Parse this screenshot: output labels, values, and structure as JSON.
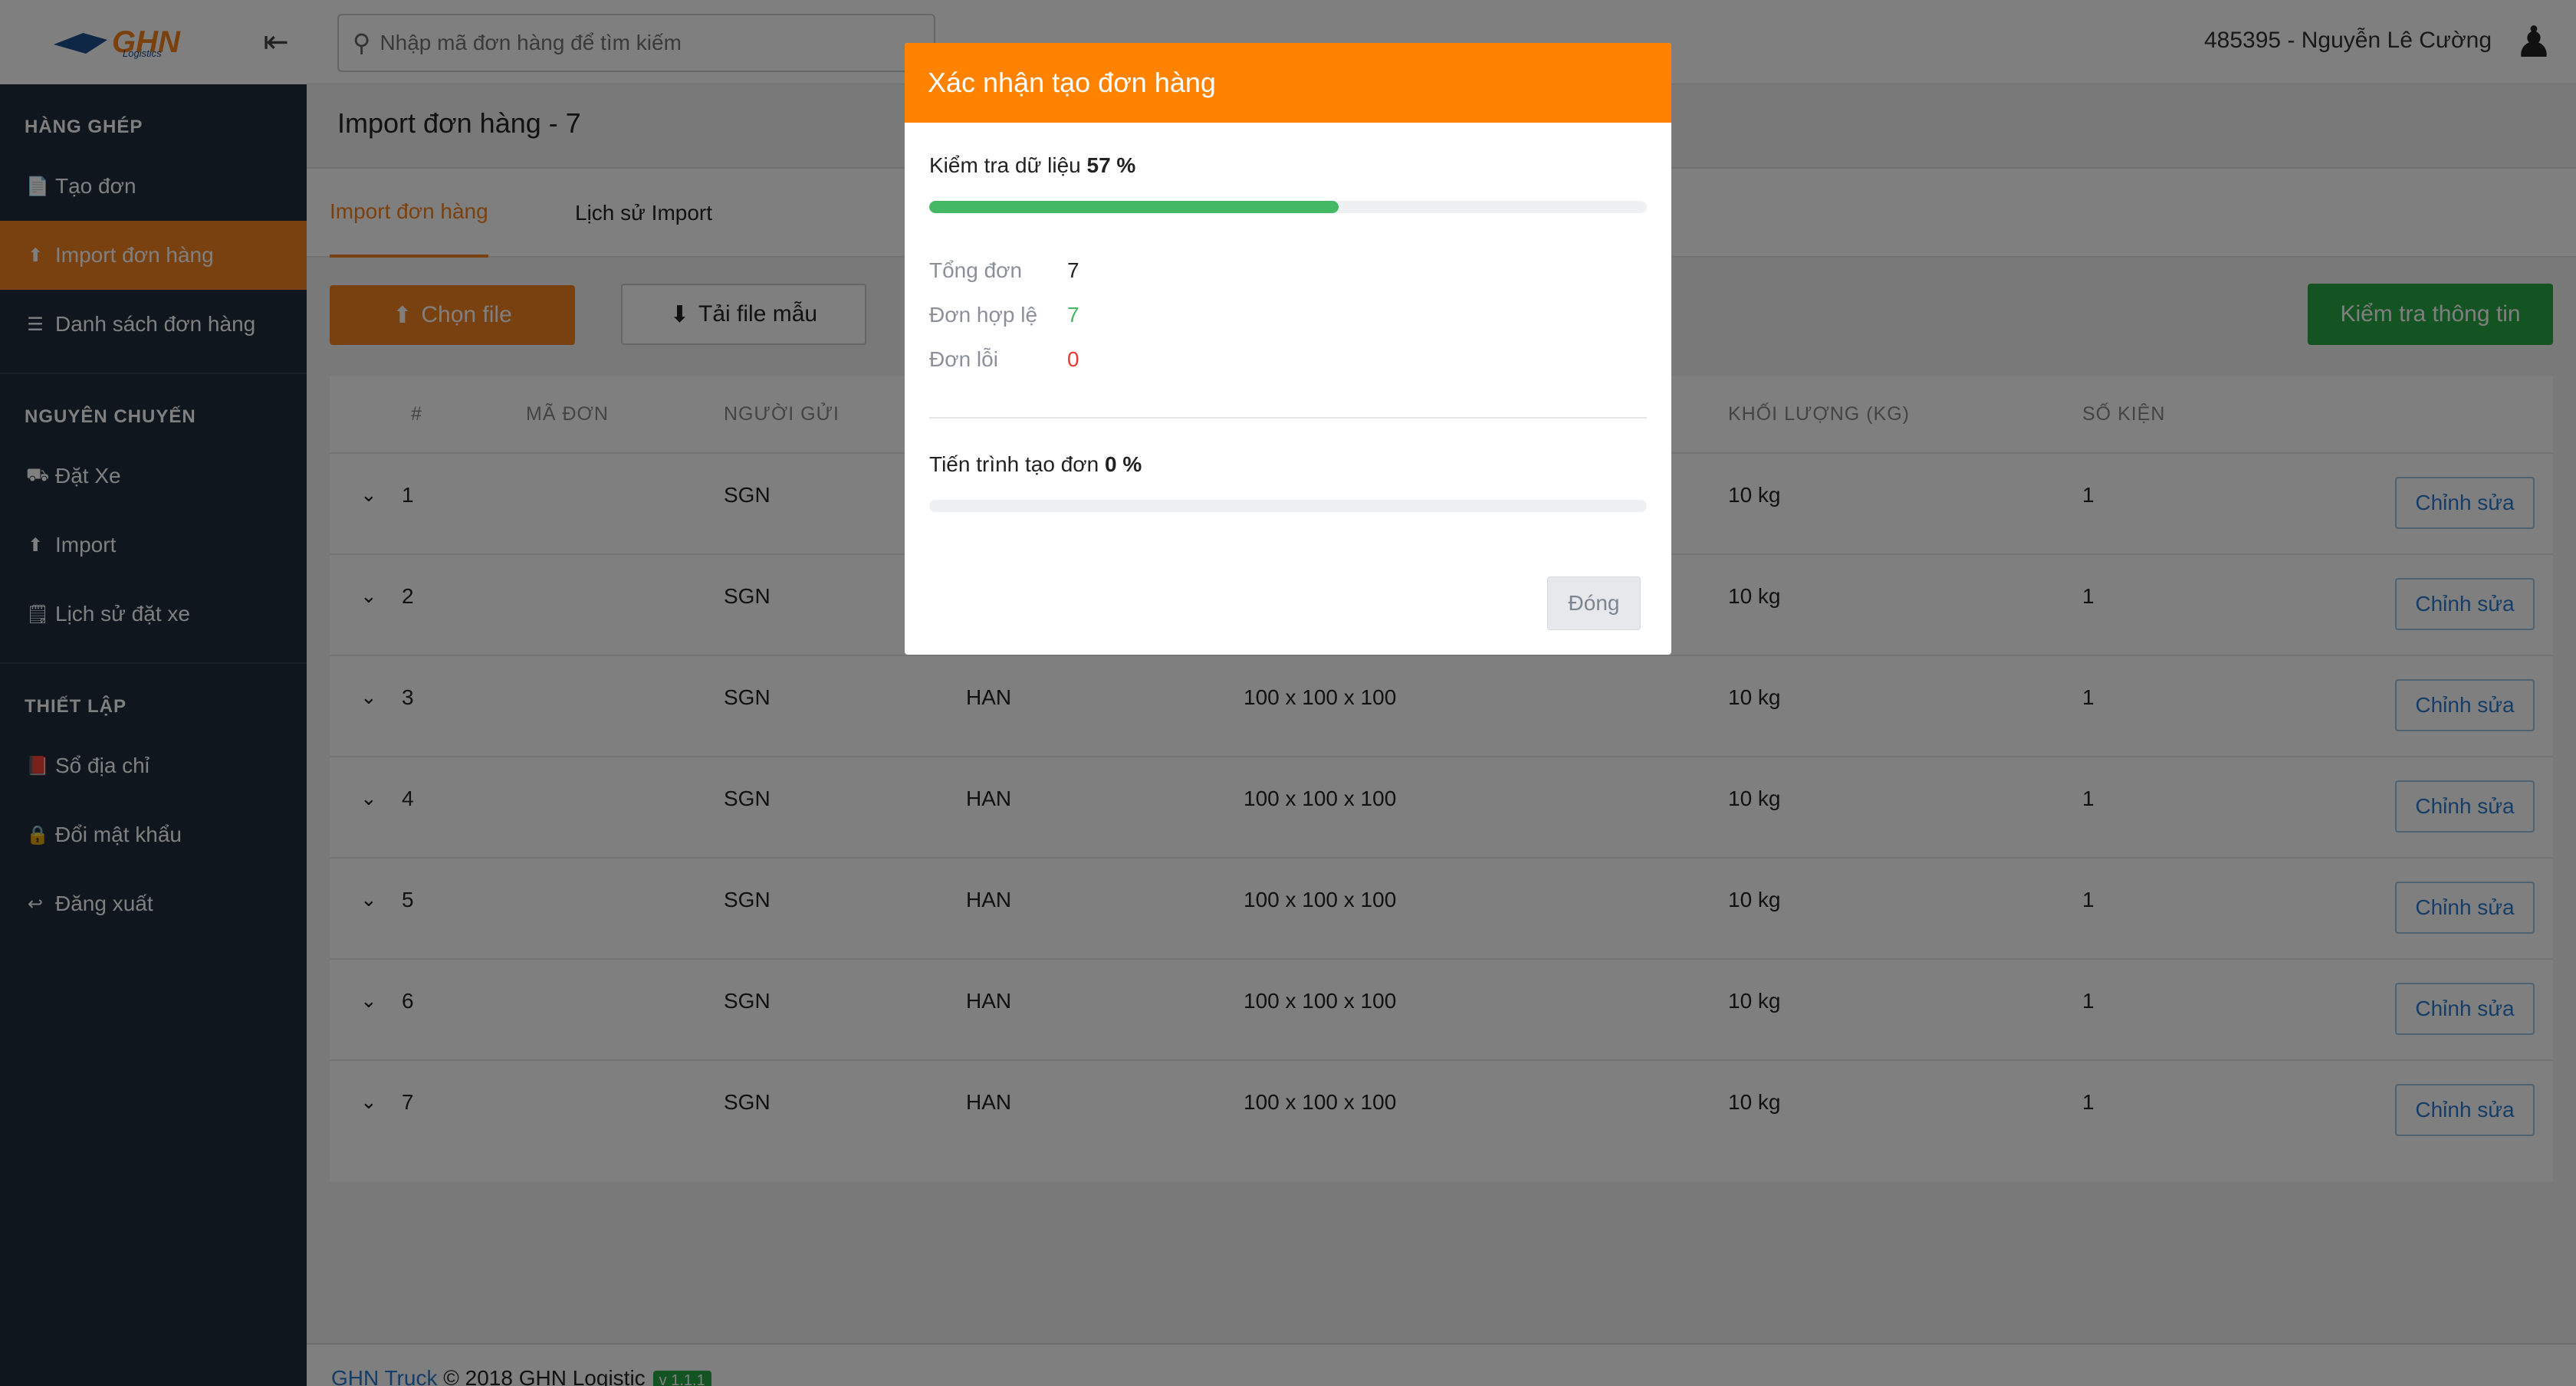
{
  "brand": {
    "logo_text": "GHN",
    "logo_sub": "Logistics"
  },
  "topbar": {
    "search_placeholder": "Nhập mã đơn hàng để tìm kiếm",
    "user": "485395 - Nguyễn Lê Cường"
  },
  "sidebar": {
    "sections": [
      {
        "title": "HÀNG GHÉP",
        "items": [
          {
            "label": "Tạo đơn",
            "icon": "document-icon",
            "active": false
          },
          {
            "label": "Import đơn hàng",
            "icon": "upload-icon",
            "active": true
          },
          {
            "label": "Danh sách đơn hàng",
            "icon": "list-icon",
            "active": false
          }
        ]
      },
      {
        "title": "NGUYÊN CHUYẾN",
        "items": [
          {
            "label": "Đặt Xe",
            "icon": "truck-icon",
            "active": false
          },
          {
            "label": "Import",
            "icon": "upload-icon",
            "active": false
          },
          {
            "label": "Lịch sử đặt xe",
            "icon": "history-icon",
            "active": false
          }
        ]
      },
      {
        "title": "THIẾT LẬP",
        "items": [
          {
            "label": "Sổ địa chỉ",
            "icon": "address-book-icon",
            "active": false
          },
          {
            "label": "Đổi mật khẩu",
            "icon": "lock-icon",
            "active": false
          },
          {
            "label": "Đăng xuất",
            "icon": "logout-icon",
            "active": false
          }
        ]
      }
    ]
  },
  "page": {
    "title": "Import đơn hàng - 7"
  },
  "tabs": [
    {
      "label": "Import đơn hàng",
      "active": true
    },
    {
      "label": "Lịch sử Import",
      "active": false
    }
  ],
  "toolbar": {
    "choose_file": "Chọn file",
    "download_template": "Tải file mẫu",
    "check_info": "Kiểm tra thông tin"
  },
  "table": {
    "headers": [
      "#",
      "MÃ ĐƠN",
      "NGƯỜI GỬI",
      "KHỐI LƯỢNG (KG)",
      "SỐ KIỆN"
    ],
    "edit_label": "Chỉnh sửa",
    "rows": [
      {
        "no": "1",
        "from": "SGN",
        "to": "",
        "dims": "",
        "weight": "10 kg",
        "qty": "1"
      },
      {
        "no": "2",
        "from": "SGN",
        "to": "",
        "dims": "",
        "weight": "10 kg",
        "qty": "1"
      },
      {
        "no": "3",
        "from": "SGN",
        "to": "HAN",
        "dims": "100 x 100 x 100",
        "weight": "10 kg",
        "qty": "1"
      },
      {
        "no": "4",
        "from": "SGN",
        "to": "HAN",
        "dims": "100 x 100 x 100",
        "weight": "10 kg",
        "qty": "1"
      },
      {
        "no": "5",
        "from": "SGN",
        "to": "HAN",
        "dims": "100 x 100 x 100",
        "weight": "10 kg",
        "qty": "1"
      },
      {
        "no": "6",
        "from": "SGN",
        "to": "HAN",
        "dims": "100 x 100 x 100",
        "weight": "10 kg",
        "qty": "1"
      },
      {
        "no": "7",
        "from": "SGN",
        "to": "HAN",
        "dims": "100 x 100 x 100",
        "weight": "10 kg",
        "qty": "1"
      }
    ]
  },
  "footer": {
    "link": "GHN Truck",
    "text": " © 2018 GHN Logistic",
    "version": "v 1.1.1"
  },
  "modal": {
    "title": "Xác nhận tạo đơn hàng",
    "check_label": "Kiểm tra dữ liệu",
    "check_percent": "57 %",
    "check_progress": 57,
    "stats": [
      {
        "label": "Tổng đơn",
        "value": "7",
        "tone": "normal"
      },
      {
        "label": "Đơn hợp lệ",
        "value": "7",
        "tone": "green"
      },
      {
        "label": "Đơn lỗi",
        "value": "0",
        "tone": "red"
      }
    ],
    "create_label": "Tiến trình tạo đơn",
    "create_percent": "0 %",
    "create_progress": 0,
    "close_label": "Đóng"
  },
  "colors": {
    "brand_orange": "#f58220",
    "modal_header": "#ff8200",
    "sidebar_bg": "#1f2d3d",
    "success_green": "#28a745",
    "progress_green": "#45b864",
    "error_red": "#e53935"
  }
}
